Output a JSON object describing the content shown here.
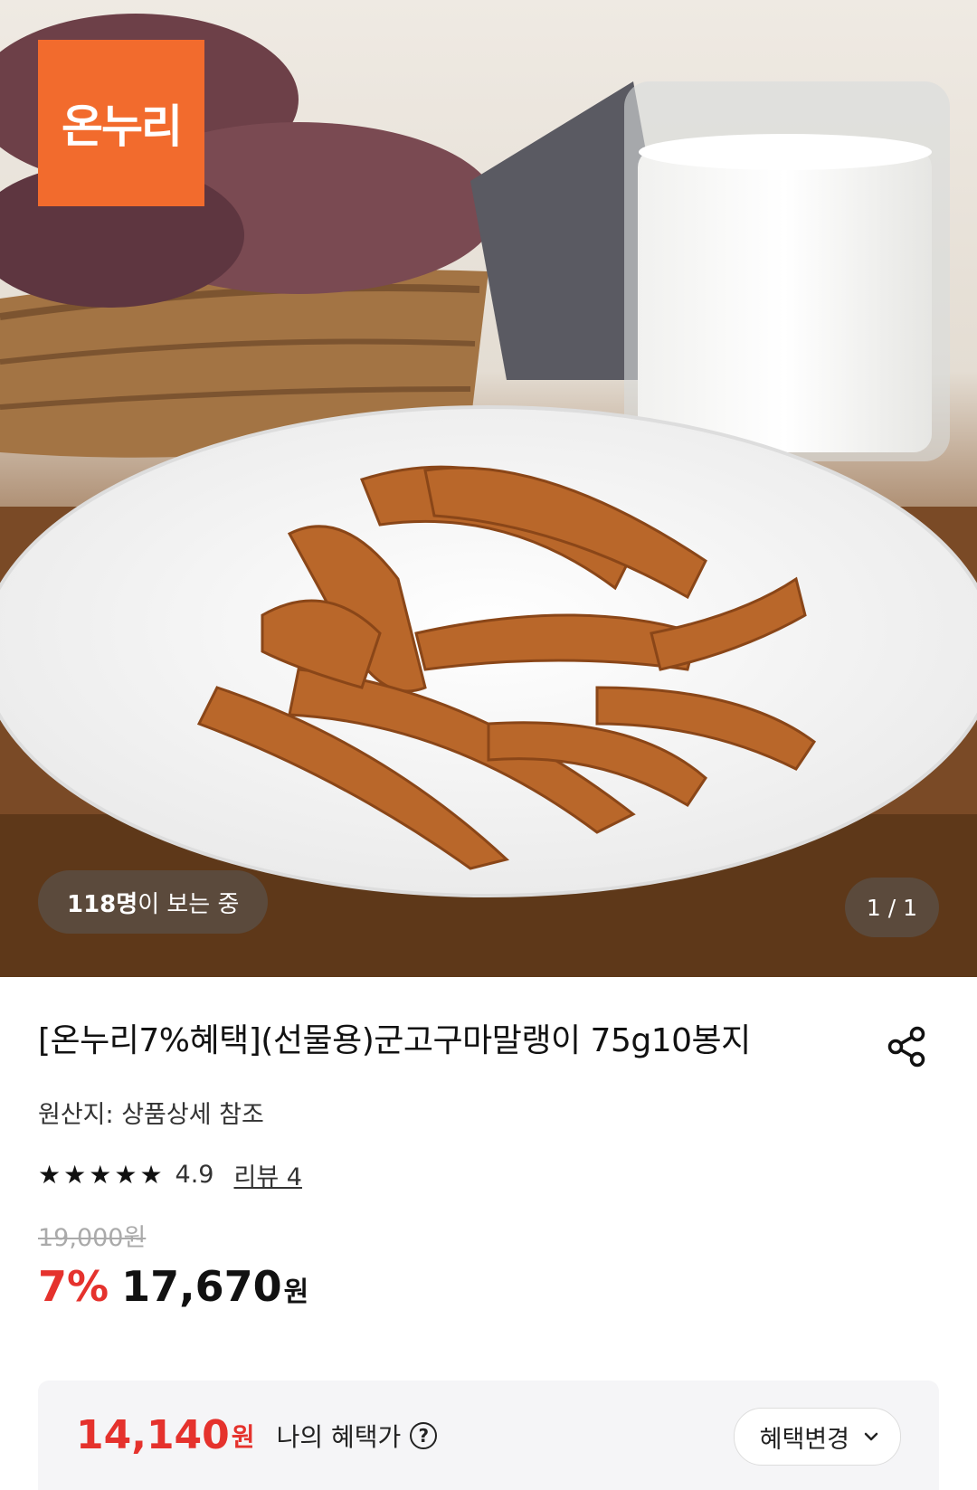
{
  "hero": {
    "logo_text": "온누리",
    "viewer_count": "118명",
    "viewer_suffix": "이 보는 중",
    "image_counter": "1 / 1"
  },
  "product": {
    "title": "[온누리7%혜택](선물용)군고구마말랭이 75g10봉지",
    "origin": "원산지: 상품상세 참조",
    "rating": 4.9,
    "rating_text": "4.9",
    "review_text": "리뷰 4",
    "original_price": "19,000원",
    "discount_rate": "7%",
    "sale_price": "17,670",
    "sale_unit": "원"
  },
  "benefit": {
    "price": "14,140",
    "unit": "원",
    "label": "나의 혜택가",
    "help_icon": "?",
    "change_label": "혜택변경"
  },
  "icons": {
    "share": "share-icon",
    "star": "star-icon",
    "help": "question-circle-icon",
    "chevron": "chevron-down-icon"
  },
  "colors": {
    "brand": "#f26b2d",
    "discount": "#e5322d",
    "benefit_bg": "#f5f5f7"
  }
}
